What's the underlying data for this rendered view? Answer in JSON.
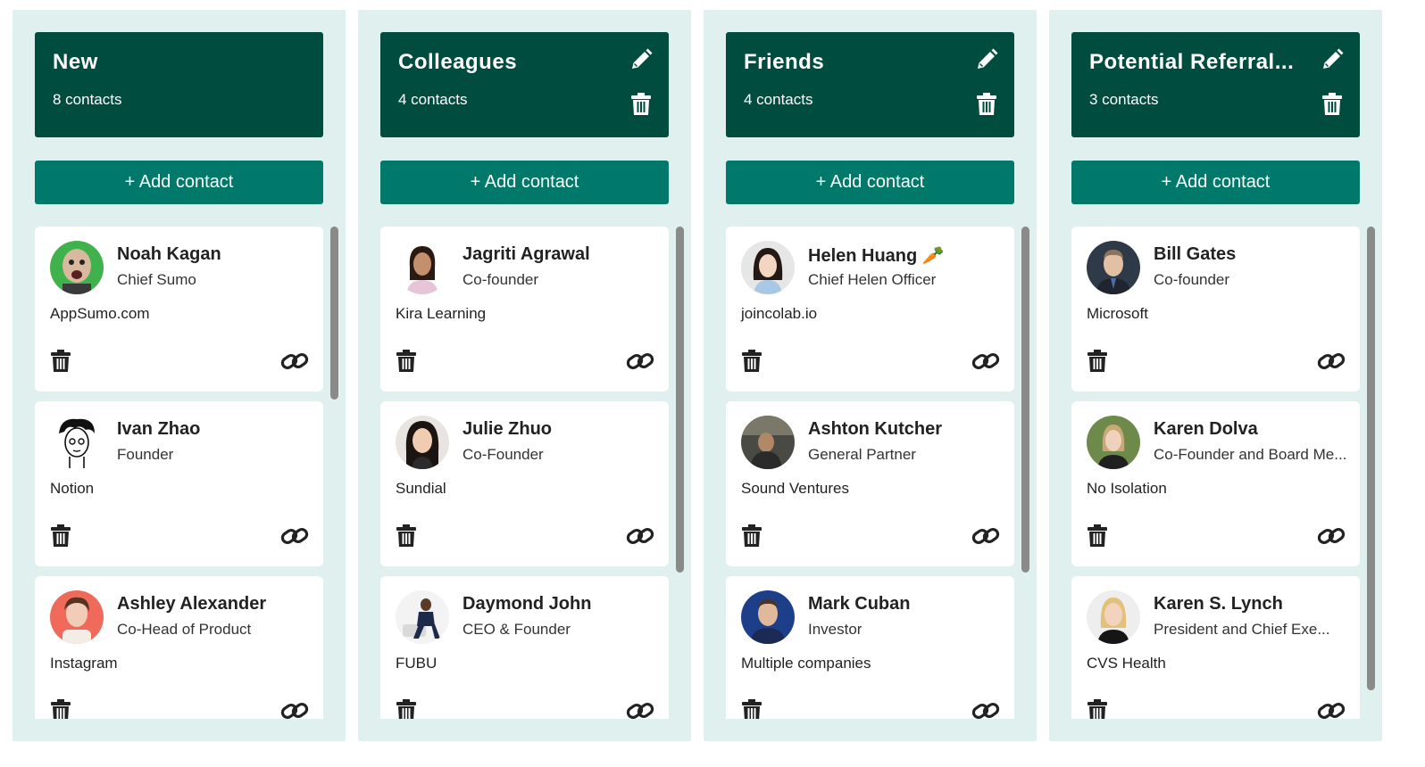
{
  "add_contact_label": "+ Add contact",
  "colors": {
    "column_bg": "#dff0ef",
    "header_bg": "#004d40",
    "button_bg": "#00796b",
    "card_bg": "#ffffff"
  },
  "columns": [
    {
      "title": "New",
      "count": "8 contacts",
      "contacts": [
        {
          "name": "Noah Kagan",
          "role": "Chief Sumo",
          "company": "AppSumo.com"
        },
        {
          "name": "Ivan Zhao",
          "role": "Founder",
          "company": "Notion"
        },
        {
          "name": "Ashley Alexander",
          "role": "Co-Head of Product",
          "company": "Instagram"
        }
      ]
    },
    {
      "title": "Colleagues",
      "count": "4 contacts",
      "contacts": [
        {
          "name": "Jagriti Agrawal",
          "role": "Co-founder",
          "company": "Kira Learning"
        },
        {
          "name": "Julie Zhuo",
          "role": "Co-Founder",
          "company": "Sundial"
        },
        {
          "name": "Daymond John",
          "role": "CEO & Founder",
          "company": "FUBU"
        }
      ]
    },
    {
      "title": "Friends",
      "count": "4 contacts",
      "contacts": [
        {
          "name": "Helen Huang 🥕",
          "role": "Chief Helen Officer",
          "company": "joincolab.io"
        },
        {
          "name": "Ashton Kutcher",
          "role": "General Partner",
          "company": "Sound Ventures"
        },
        {
          "name": "Mark Cuban",
          "role": "Investor",
          "company": "Multiple companies"
        }
      ]
    },
    {
      "title": "Potential Referral...",
      "count": "3 contacts",
      "contacts": [
        {
          "name": "Bill Gates",
          "role": "Co-founder",
          "company": "Microsoft"
        },
        {
          "name": "Karen Dolva",
          "role": "Co-Founder and Board Me...",
          "company": "No Isolation"
        },
        {
          "name": "Karen S. Lynch",
          "role": "President and Chief Exe...",
          "company": "CVS Health"
        }
      ]
    }
  ]
}
